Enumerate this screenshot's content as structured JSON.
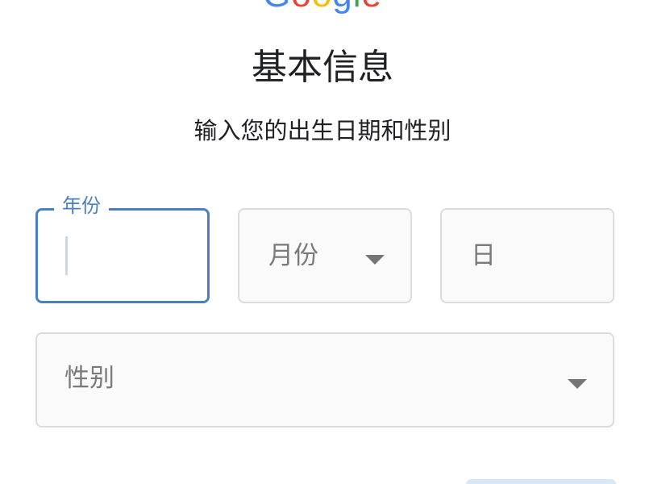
{
  "logo": {
    "letters": [
      "G",
      "o",
      "o",
      "g",
      "l",
      "e"
    ],
    "colors": [
      "#4285F4",
      "#EA4335",
      "#FBBC05",
      "#4285F4",
      "#34A853",
      "#EA4335"
    ]
  },
  "header": {
    "title": "基本信息",
    "subtitle": "输入您的出生日期和性别"
  },
  "form": {
    "year": {
      "label": "年份",
      "value": ""
    },
    "month": {
      "placeholder": "月份"
    },
    "day": {
      "placeholder": "日"
    },
    "gender": {
      "placeholder": "性别"
    }
  },
  "colors": {
    "focus": "#4a7fc1",
    "border": "#dadce0",
    "text": "#202124",
    "placeholder": "#7a7a7a"
  }
}
